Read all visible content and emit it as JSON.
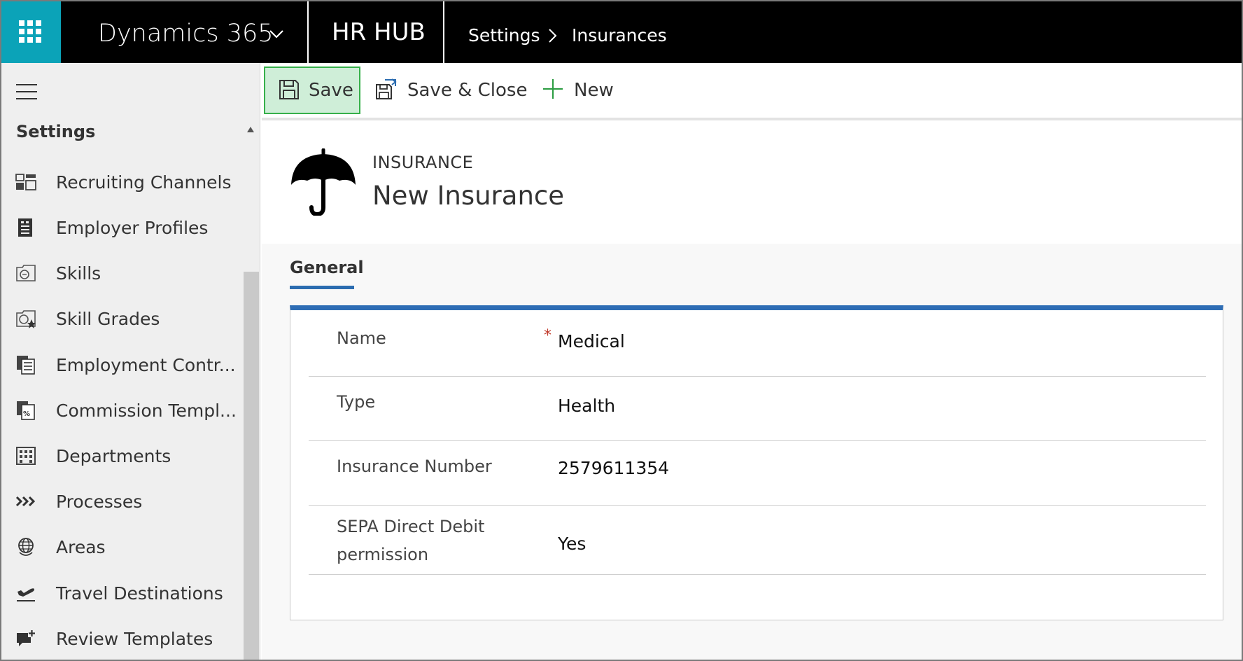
{
  "topbar": {
    "app_name": "Dynamics 365",
    "hub_name": "HR HUB",
    "breadcrumb": [
      "Settings",
      "Insurances"
    ]
  },
  "sidebar": {
    "title": "Settings",
    "items": [
      {
        "label": "Recruiting Channels",
        "icon": "recruiting-channels-icon"
      },
      {
        "label": "Employer Profiles",
        "icon": "employer-profiles-icon"
      },
      {
        "label": "Skills",
        "icon": "skills-icon"
      },
      {
        "label": "Skill Grades",
        "icon": "skill-grades-icon"
      },
      {
        "label": "Employment Contr...",
        "icon": "employment-contracts-icon"
      },
      {
        "label": "Commission Templ...",
        "icon": "commission-templates-icon"
      },
      {
        "label": "Departments",
        "icon": "departments-icon"
      },
      {
        "label": "Processes",
        "icon": "processes-icon"
      },
      {
        "label": "Areas",
        "icon": "globe-icon"
      },
      {
        "label": "Travel Destinations",
        "icon": "plane-icon"
      },
      {
        "label": "Review Templates",
        "icon": "review-templates-icon"
      }
    ]
  },
  "commands": {
    "save": "Save",
    "save_close": "Save & Close",
    "new": "New"
  },
  "record": {
    "entity": "INSURANCE",
    "title": "New Insurance"
  },
  "tabs": {
    "general": "General"
  },
  "fields": [
    {
      "label": "Name",
      "value": "Medical",
      "required": true
    },
    {
      "label": "Type",
      "value": "Health",
      "required": false
    },
    {
      "label": "Insurance Number",
      "value": "2579611354",
      "required": false
    },
    {
      "label": "SEPA Direct Debit permission",
      "value": "Yes",
      "required": false
    }
  ],
  "required_marker": "*",
  "colors": {
    "waffle": "#0ba3b8",
    "topbar": "#000000",
    "accent": "#2e6db5",
    "save_highlight": "#cfeed8",
    "new_plus": "#2f9e44"
  }
}
